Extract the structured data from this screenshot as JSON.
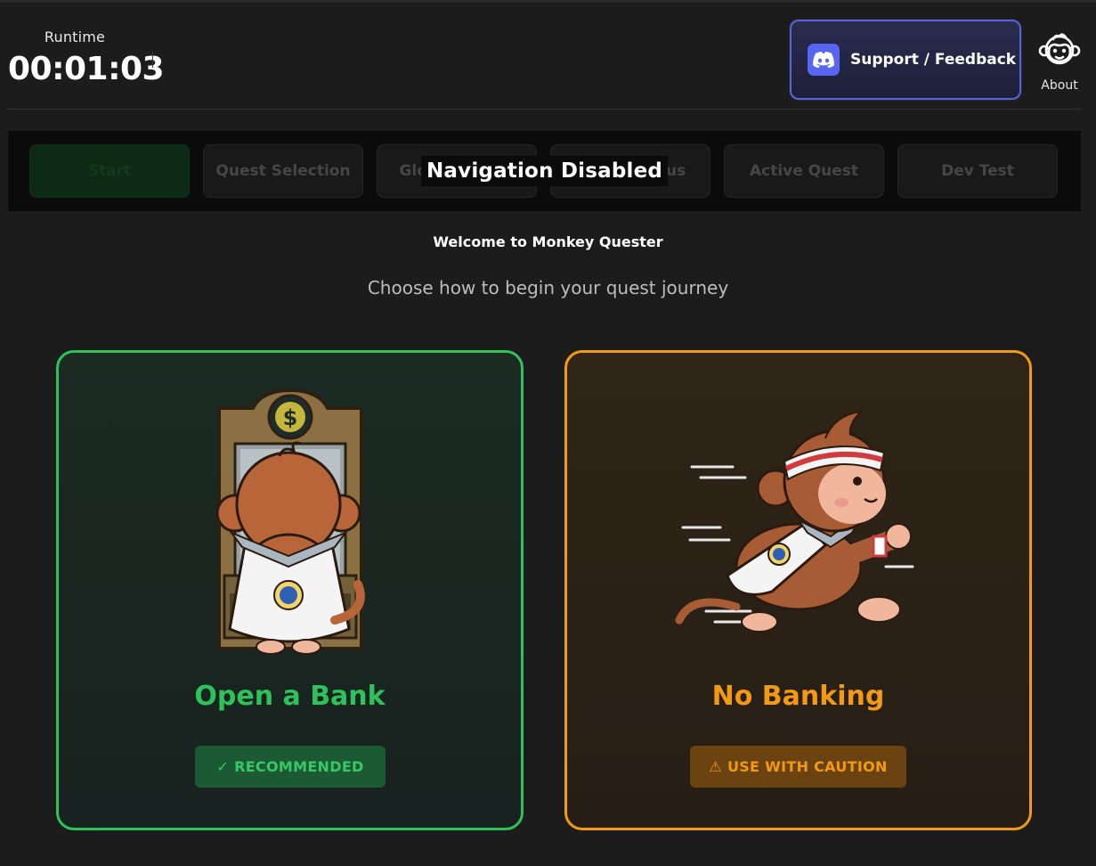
{
  "header": {
    "runtime_label": "Runtime",
    "runtime_value": "00:01:03",
    "support_label": "Support / Feedback",
    "about_label": "About"
  },
  "nav": {
    "tabs": [
      {
        "label": "Start",
        "icon": null
      },
      {
        "label": "Quest Selection"
      },
      {
        "label": "Global Status"
      },
      {
        "label": "Quest Status"
      },
      {
        "label": "Active Quest"
      },
      {
        "label": "Dev Test"
      }
    ],
    "overlay": "Navigation Disabled"
  },
  "main": {
    "welcome": "Welcome to Monkey Quester",
    "subtitle": "Choose how to begin your quest journey",
    "cards": [
      {
        "title": "Open a Bank",
        "badge_icon": "✓",
        "badge": "RECOMMENDED",
        "accent": "#2fc25b"
      },
      {
        "title": "No Banking",
        "badge_icon": "⚠",
        "badge": "USE WITH CAUTION",
        "accent": "#f39a12"
      }
    ]
  },
  "colors": {
    "background": "#1c1c1c",
    "discord": "#5865f2",
    "support_border": "#5b63d9"
  }
}
